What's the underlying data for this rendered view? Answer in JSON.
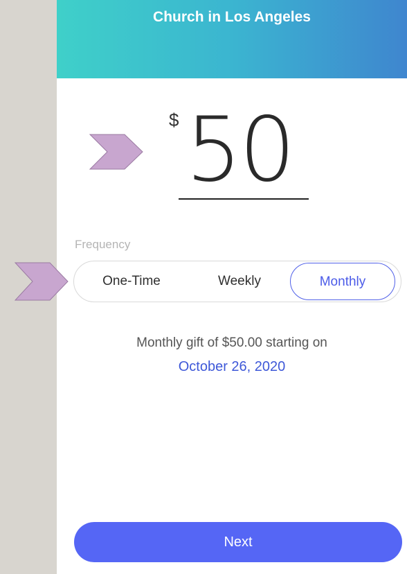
{
  "header": {
    "title": "Church in Los Angeles"
  },
  "amount": {
    "currency": "$",
    "value": "50"
  },
  "frequency": {
    "label": "Frequency",
    "options": [
      "One-Time",
      "Weekly",
      "Monthly"
    ],
    "selected": "Monthly"
  },
  "summary": {
    "text": "Monthly gift of $50.00 starting on",
    "date": "October 26, 2020"
  },
  "footer": {
    "next_label": "Next"
  },
  "colors": {
    "header_gradient_start": "#3fd0c9",
    "header_gradient_end": "#3f86cf",
    "accent": "#5566f5",
    "selected_text": "#4b5be8",
    "annotation_arrow": "#c8a6cf"
  },
  "annotations": {
    "arrow_icon_1": "chevron-right-icon",
    "arrow_icon_2": "chevron-right-icon"
  }
}
